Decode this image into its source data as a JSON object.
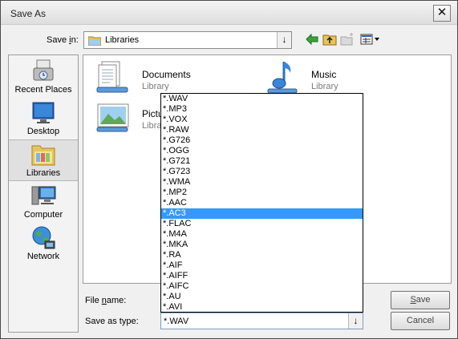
{
  "window": {
    "title": "Save As",
    "close_glyph": "✕"
  },
  "toolbar": {
    "save_in_prefix": "Save ",
    "save_in_accel": "i",
    "save_in_suffix": "n:",
    "save_in_value": "Libraries",
    "dropdown_glyph": "↓",
    "icons": [
      "back-arrow-icon",
      "up-folder-icon",
      "new-folder-icon",
      "view-menu-icon"
    ]
  },
  "places": [
    {
      "label": "Recent Places",
      "icon": "recent-places-icon"
    },
    {
      "label": "Desktop",
      "icon": "desktop-icon"
    },
    {
      "label": "Libraries",
      "icon": "libraries-icon",
      "selected": true
    },
    {
      "label": "Computer",
      "icon": "computer-icon"
    },
    {
      "label": "Network",
      "icon": "network-icon"
    }
  ],
  "libraries": [
    {
      "name": "Documents",
      "sub": "Library",
      "icon": "documents-library-icon"
    },
    {
      "name": "Music",
      "sub": "Library",
      "icon": "music-library-icon"
    },
    {
      "name": "Picture",
      "sub": "Library",
      "icon": "pictures-library-icon"
    }
  ],
  "form": {
    "file_name_prefix": "File ",
    "file_name_accel": "n",
    "file_name_suffix": "ame:",
    "save_as_type_label": "Save as type:",
    "save_as_type_value": "*.WAV"
  },
  "type_options": [
    "*.WAV",
    "*.MP3",
    "*.VOX",
    "*.RAW",
    "*.G726",
    "*.OGG",
    "*.G721",
    "*.G723",
    "*.WMA",
    "*.MP2",
    "*.AAC",
    "*.AC3",
    "*.FLAC",
    "*.M4A",
    "*.MKA",
    "*.RA",
    "*.AIF",
    "*.AIFF",
    "*.AIFC",
    "*.AU",
    "*.AVI"
  ],
  "selected_type_index": 11,
  "buttons": {
    "save_accel": "S",
    "save_rest": "ave",
    "cancel": "Cancel"
  },
  "colors": {
    "selection": "#3399ff",
    "library_sub": "#7b7b7b"
  }
}
